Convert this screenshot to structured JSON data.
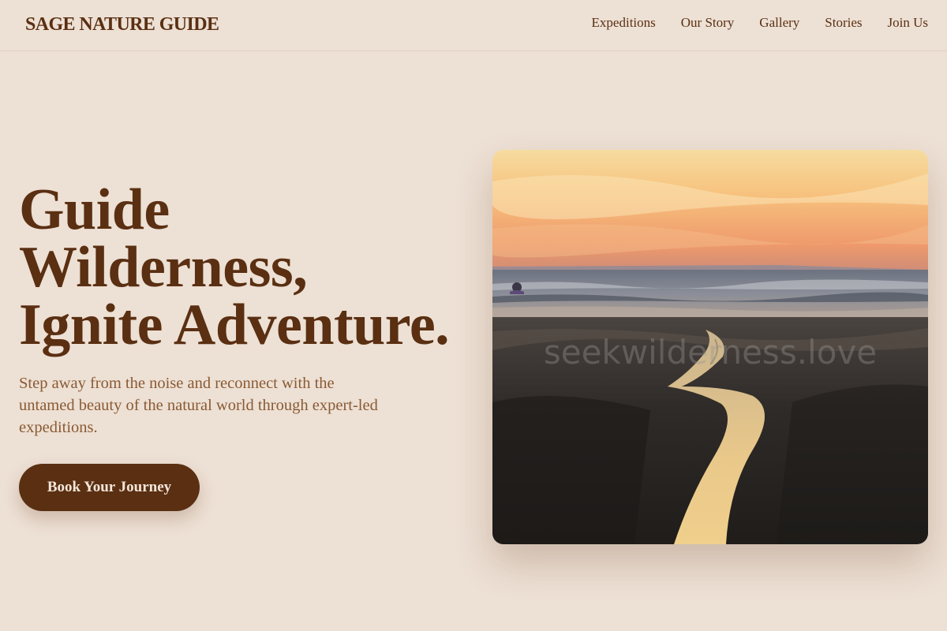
{
  "brand": "SAGE NATURE GUIDE",
  "nav": {
    "items": [
      {
        "label": "Expeditions"
      },
      {
        "label": "Our Story"
      },
      {
        "label": "Gallery"
      },
      {
        "label": "Stories"
      },
      {
        "label": "Join Us"
      }
    ]
  },
  "hero": {
    "title_lines": [
      "Guide",
      "Wilderness,",
      "Ignite Adventure."
    ],
    "subtitle": "Step away from the noise and reconnect with the untamed beauty of the natural world through expert-led expeditions.",
    "cta_label": "Book Your Journey",
    "image": {
      "description_icon": "sunset-beach-photo",
      "watermark": "seekwilderness.love"
    }
  },
  "colors": {
    "background": "#ede0d4",
    "primary": "#5a2f12",
    "muted_text": "#8a5a34",
    "button_text": "#f3e6da"
  }
}
